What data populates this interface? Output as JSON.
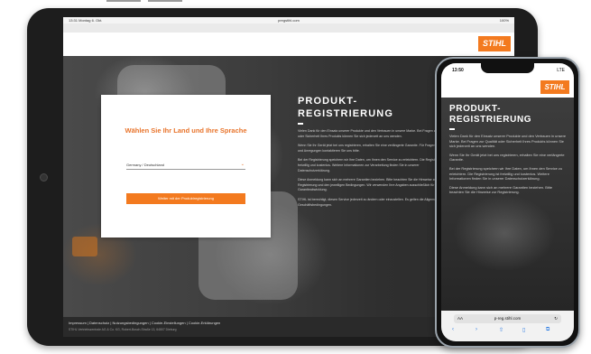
{
  "tablet": {
    "status": {
      "time": "13:31 Montag 6. Okt.",
      "url": "pregstihl.com",
      "battery": "100%"
    },
    "brand_logo": "STIHL",
    "modal": {
      "title": "Wählen Sie Ihr Land und Ihre Sprache",
      "select_value": "Germany / Deutschland",
      "submit_label": "Weiter mit der Produktregistrierung"
    },
    "content": {
      "title": "PRODUKT-REGISTRIERUNG",
      "paragraphs": [
        "Vielen Dank für den Einsatz unserer Produkte und den Vertrauen in unsere Marke. Bei Fragen zur Qualität oder Sicherheit Ihres Produkts können Sie sich jederzeit an uns wenden.",
        "Wenn Sie Ihr Gerät jetzt bei uns registrieren, erhalten Sie eine verlängerte Garantie. Für Fragen, Wünsche und Anregungen kontaktieren Sie uns bitte.",
        "Bei der Registrierung speichern wir Ihre Daten, um Ihnen den Service zu erleichtern. Die Registrierung ist freiwillig und kostenlos. Weitere Informationen zur Verarbeitung finden Sie in unserer Datenschutzerklärung.",
        "Diese Anmeldung kann sich an mehrere Garantien beziehen. Bitte beachten Sie die Hinweise zur Registrierung und den jeweiligen Bedingungen. Wir verwenden Ihre Angaben ausschließlich für die Garantieabwicklung.",
        "STIHL ist berechtigt, diesen Service jederzeit zu ändern oder einzustellen. Es gelten die Allgemeinen Geschäftsbedingungen."
      ]
    },
    "footer": {
      "links": "Impressum | Datenschutz | Nutzungsbedingungen | Cookie-Einstellungen | Cookie-Erklärungen",
      "copyright": "STIHL Vertriebszentrale AG & Co. KG, Robert-Bosch-Straße 13, 64807 Dieburg"
    }
  },
  "phone": {
    "status": {
      "time": "13:50",
      "signal": "LTE"
    },
    "brand_logo": "STIHL",
    "content": {
      "title": "PRODUKT-REGISTRIERUNG",
      "paragraphs": [
        "Vielen Dank für den Einsatz unserer Produkte und den Vertrauen in unsere Marke. Bei Fragen zur Qualität oder Sicherheit Ihres Produkts können Sie sich jederzeit an uns wenden.",
        "Wenn Sie Ihr Gerät jetzt bei uns registrieren, erhalten Sie eine verlängerte Garantie.",
        "Bei der Registrierung speichern wir Ihre Daten, um Ihnen den Service zu erleichtern. Die Registrierung ist freiwillig und kostenlos. Weitere Informationen finden Sie in unserer Datenschutzerklärung.",
        "Diese Anmeldung kann sich an mehrere Garantien beziehen. Bitte beachten Sie die Hinweise zur Registrierung."
      ]
    },
    "browser": {
      "aa": "AA",
      "url": "p-reg.stihl.com",
      "reload": "↻"
    },
    "nav": {
      "back": "‹",
      "forward": "›",
      "share": "⇧",
      "bookmarks": "▯",
      "tabs": "⧉"
    },
    "colors": {
      "brand": "#f37a1f",
      "dark_bg": "#2c2c2c"
    }
  }
}
